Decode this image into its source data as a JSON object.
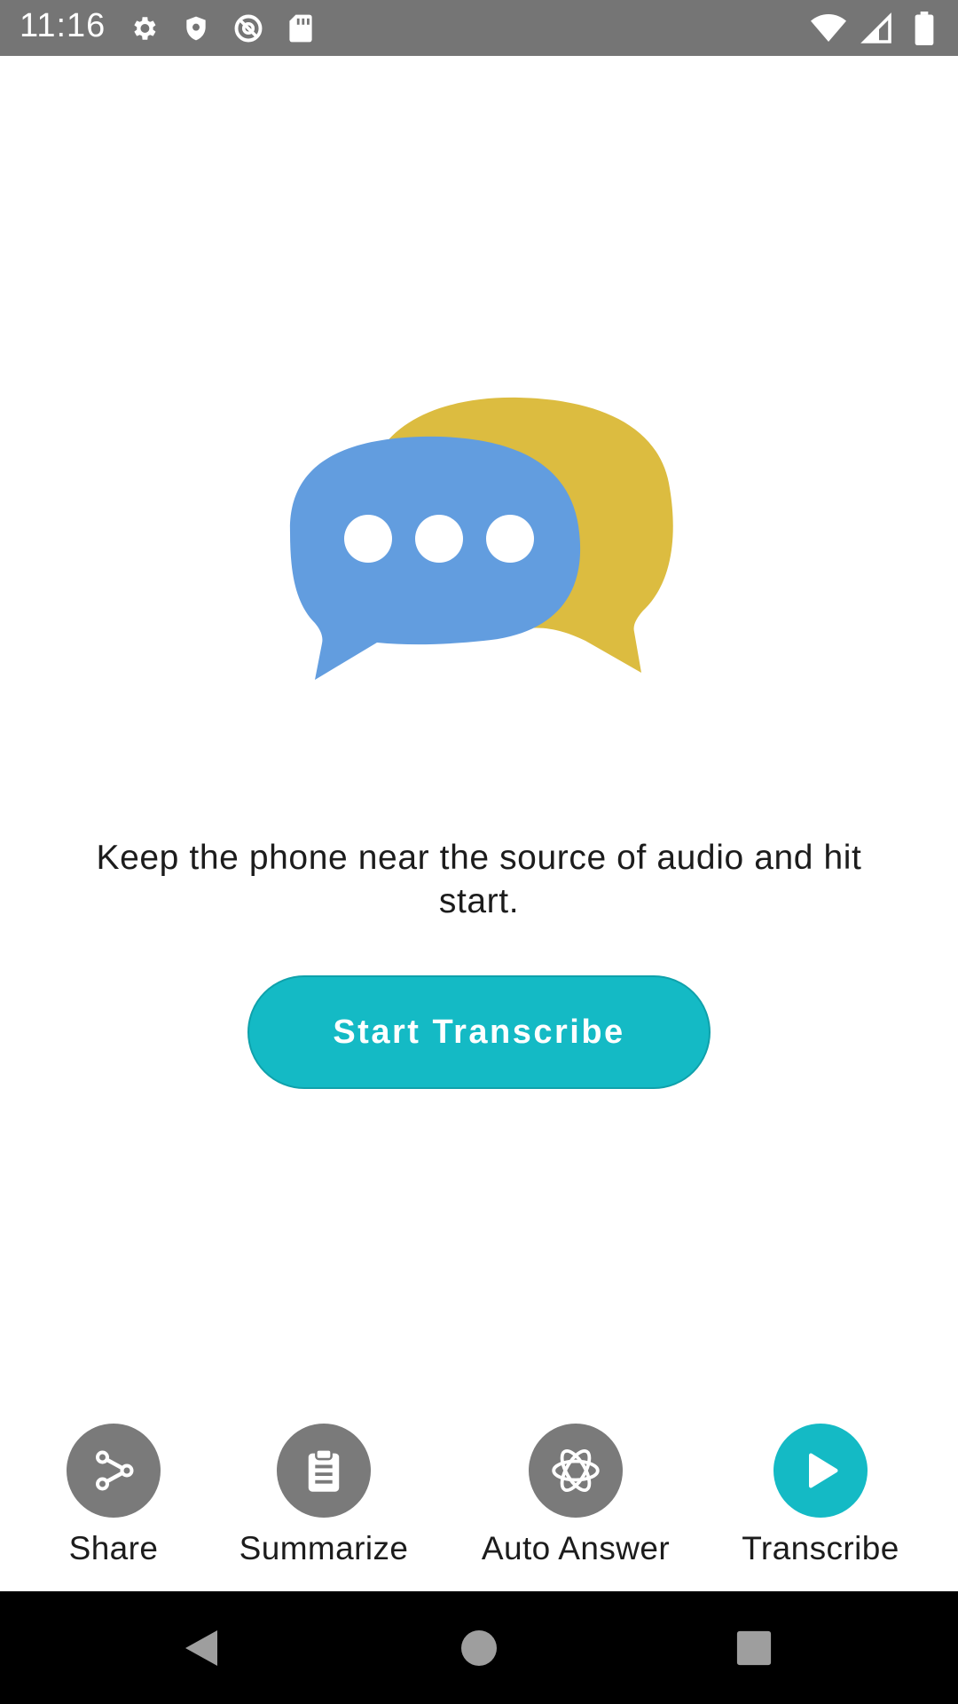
{
  "status_bar": {
    "time": "11:16",
    "left_icons": [
      "settings-icon",
      "shield-icon",
      "at-sign-icon",
      "sd-card-icon"
    ],
    "right_icons": [
      "wifi-icon",
      "cellular-signal-icon",
      "battery-icon"
    ]
  },
  "illustration": {
    "name": "chat-bubbles-illustration",
    "colors": {
      "back_bubble": "#dcbc40",
      "front_bubble": "#629ddf",
      "dots": "#ffffff"
    }
  },
  "main": {
    "instruction": "Keep the phone near the source of audio and hit start.",
    "start_button_label": "Start Transcribe"
  },
  "bottom_nav": {
    "items": [
      {
        "label": "Share",
        "icon": "share-icon",
        "color": "#7a7a7a",
        "active": false
      },
      {
        "label": "Summarize",
        "icon": "clipboard-icon",
        "color": "#7a7a7a",
        "active": false
      },
      {
        "label": "Auto Answer",
        "icon": "openai-icon",
        "color": "#7a7a7a",
        "active": false
      },
      {
        "label": "Transcribe",
        "icon": "play-icon",
        "color": "#14bac5",
        "active": true
      }
    ]
  },
  "system_nav": {
    "buttons": [
      "back-icon",
      "home-icon",
      "recents-icon"
    ]
  },
  "colors": {
    "accent": "#14bac5",
    "inactive": "#7a7a7a",
    "status_bar": "#757575"
  }
}
